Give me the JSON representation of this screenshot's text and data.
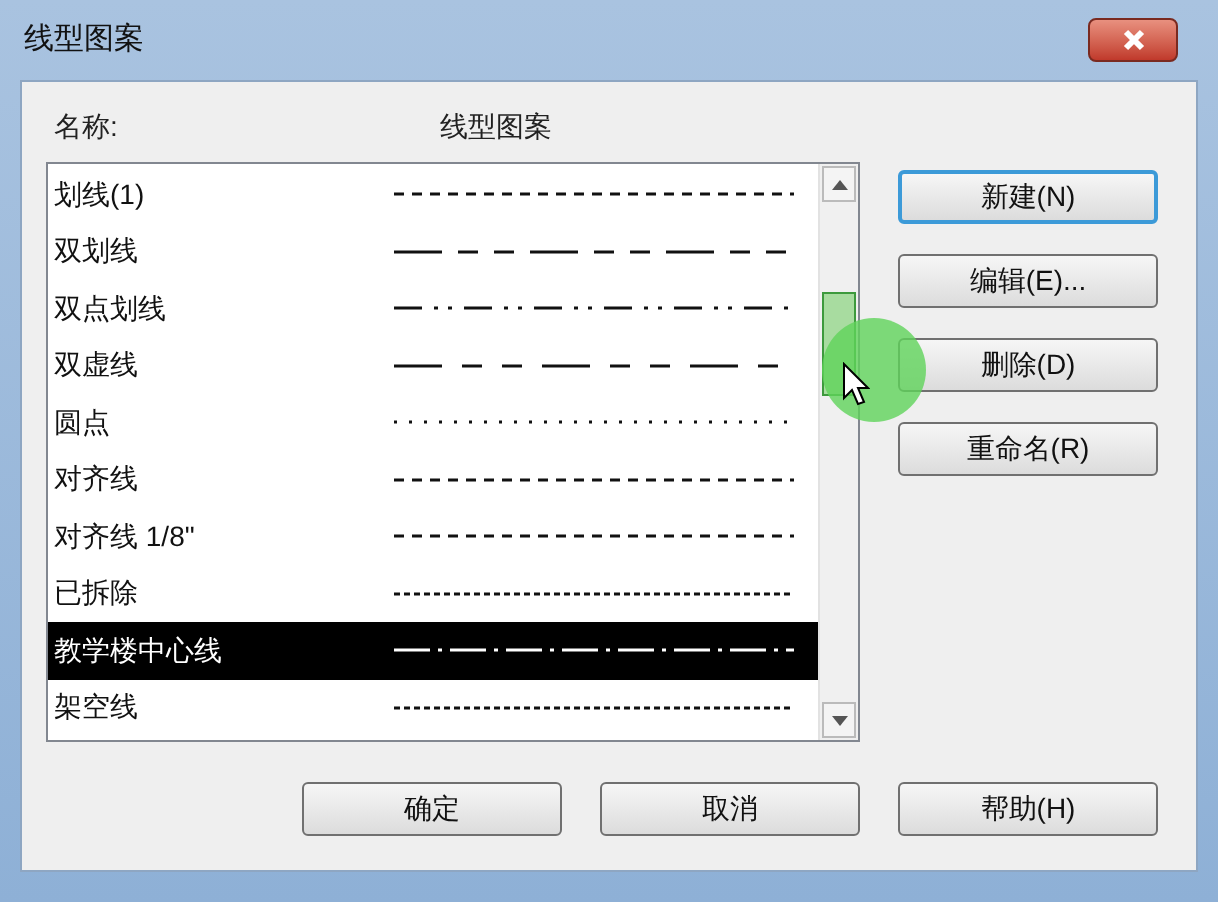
{
  "window": {
    "title": "线型图案"
  },
  "list": {
    "columns": [
      "名称:",
      "线型图案"
    ],
    "rows": [
      {
        "name": "划线(1)",
        "kind": "dash",
        "selected": false
      },
      {
        "name": "双划线",
        "kind": "double-dash",
        "selected": false
      },
      {
        "name": "双点划线",
        "kind": "double-dot-dash",
        "selected": false
      },
      {
        "name": "双虚线",
        "kind": "double-hidden",
        "selected": false
      },
      {
        "name": "圆点",
        "kind": "dot",
        "selected": false
      },
      {
        "name": "对齐线",
        "kind": "dash",
        "selected": false
      },
      {
        "name": "对齐线 1/8\"",
        "kind": "dash",
        "selected": false
      },
      {
        "name": "已拆除",
        "kind": "fine-dash",
        "selected": false
      },
      {
        "name": "教学楼中心线",
        "kind": "center",
        "selected": true
      },
      {
        "name": "架空线",
        "kind": "fine-dash",
        "selected": false
      }
    ]
  },
  "side_buttons": [
    {
      "label": "新建(N)",
      "default": true
    },
    {
      "label": "编辑(E)...",
      "default": false
    },
    {
      "label": "删除(D)",
      "default": false
    },
    {
      "label": "重命名(R)",
      "default": false
    }
  ],
  "bottom_buttons": [
    "确定",
    "取消",
    "帮助(H)"
  ]
}
